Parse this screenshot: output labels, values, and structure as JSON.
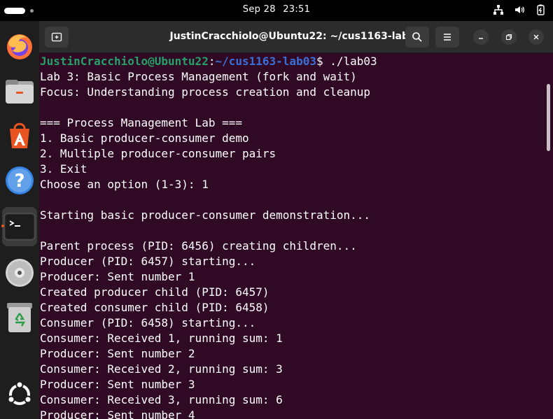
{
  "topbar": {
    "date": "Sep 28",
    "time": "23:51"
  },
  "dock": {
    "items": [
      {
        "name": "firefox-icon"
      },
      {
        "name": "files-icon"
      },
      {
        "name": "app-center-icon"
      },
      {
        "name": "help-icon"
      },
      {
        "name": "terminal-icon"
      },
      {
        "name": "disc-icon"
      },
      {
        "name": "trash-icon"
      },
      {
        "name": "ubuntu-show-apps-icon"
      }
    ]
  },
  "window": {
    "title": "JustinCracchiolo@Ubuntu22: ~/cus1163-lab03"
  },
  "terminal": {
    "prompt_user": "JustinCracchiolo@Ubuntu22",
    "prompt_sep": ":",
    "prompt_path": "~/cus1163-lab03",
    "prompt_dollar": "$ ",
    "command": "./lab03",
    "lines": [
      "Lab 3: Basic Process Management (fork and wait)",
      "Focus: Understanding process creation and cleanup",
      "",
      "=== Process Management Lab ===",
      "1. Basic producer-consumer demo",
      "2. Multiple producer-consumer pairs",
      "3. Exit",
      "Choose an option (1-3): 1",
      "",
      "Starting basic producer-consumer demonstration...",
      "",
      "Parent process (PID: 6456) creating children...",
      "Producer (PID: 6457) starting...",
      "Producer: Sent number 1",
      "Created producer child (PID: 6457)",
      "Created consumer child (PID: 6458)",
      "Consumer (PID: 6458) starting...",
      "Consumer: Received 1, running sum: 1",
      "Producer: Sent number 2",
      "Consumer: Received 2, running sum: 3",
      "Producer: Sent number 3",
      "Consumer: Received 3, running sum: 6",
      "Producer: Sent number 4"
    ]
  }
}
